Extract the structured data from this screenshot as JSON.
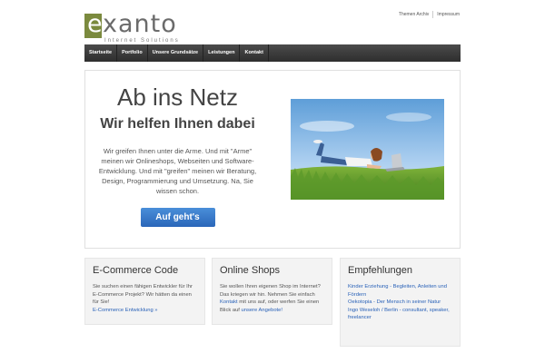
{
  "logo": {
    "first": "e",
    "rest": "xanto",
    "tagline": "Internet Solutions"
  },
  "toplinks": [
    "Themen Archiv",
    "Impressum"
  ],
  "nav": [
    "Startseite",
    "Portfolio",
    "Unsere Grundsätze",
    "Leistungen",
    "Kontakt"
  ],
  "hero": {
    "title": "Ab ins Netz",
    "subtitle": "Wir helfen Ihnen dabei",
    "text": "Wir greifen Ihnen unter die Arme. Und mit \"Arme\" meinen wir Onlineshops, Webseiten und Software-Entwicklung. Und mit \"greifen\" meinen wir Beratung, Design, Programmierung und Umsetzung. Na, Sie wissen schon.",
    "button": "Auf geht's"
  },
  "columns": {
    "ecommerce": {
      "title": "E-Commerce Code",
      "text": "Sie suchen einen fähigen Entwickler für Ihr E-Commerce Projekt? Wir hätten da einen für Sie!",
      "link": "E-Commerce Entwicklung »"
    },
    "shops": {
      "title": "Online Shops",
      "text1": "Sie wollen Ihren eigenen Shop im Internet? Das kriegen wir hin. Nehmen Sie einfach",
      "link1": "Kontakt",
      "text2": "mit uns auf, oder werfen Sie einen Blick auf",
      "link2": "unsere Angebote!"
    },
    "empfehlungen": {
      "title": "Empfehlungen",
      "link1": "Kinder Erziehung - Begleiten, Anleiten und Fördern",
      "link2": "Oekotopia - Der Mensch in seiner Natur",
      "link3": "Ingo Weseloh / Berlin - consultant, speaker, freelancer"
    }
  }
}
